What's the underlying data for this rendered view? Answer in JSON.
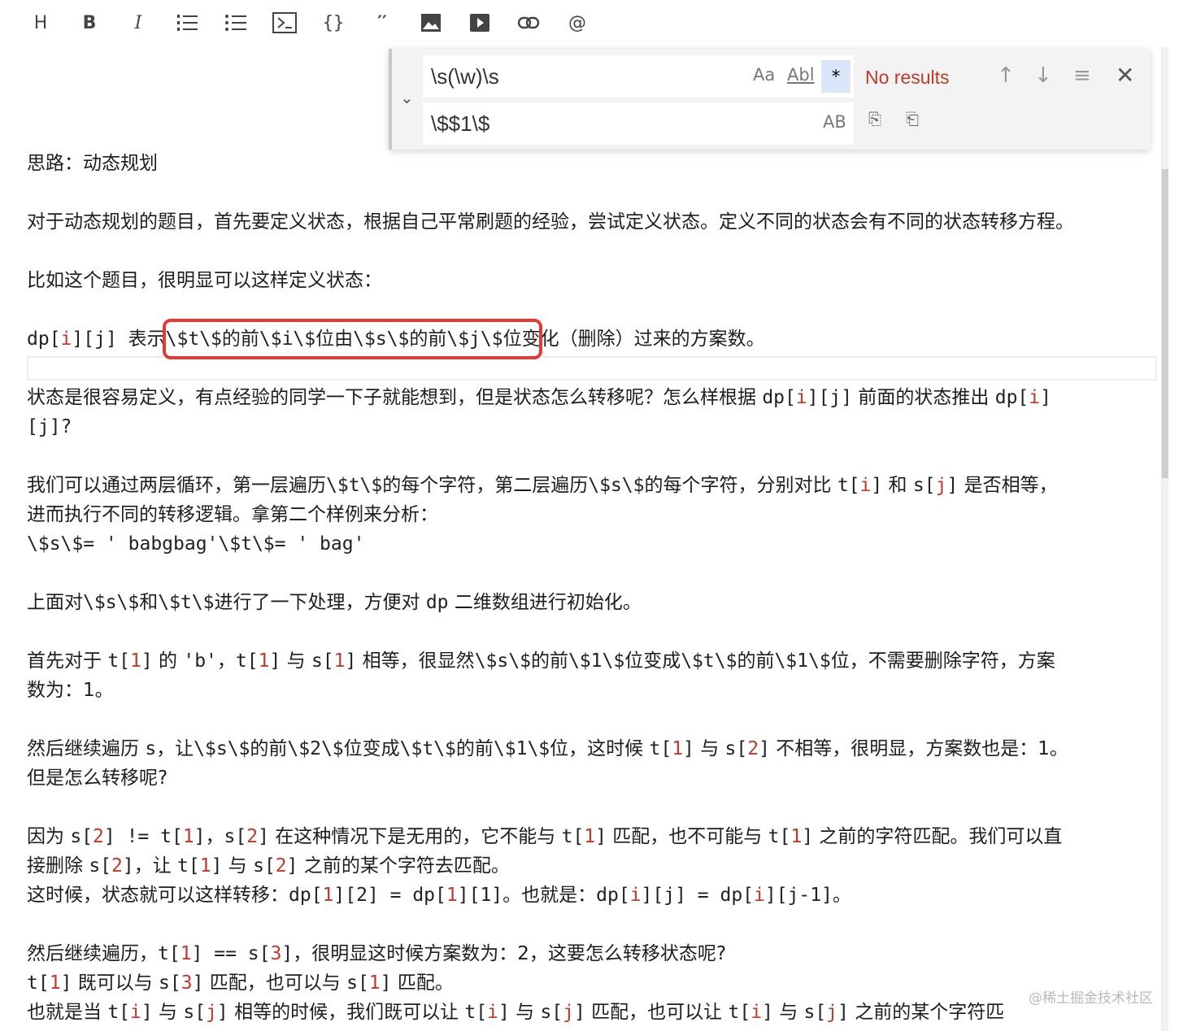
{
  "toolbar": {
    "heading": "H",
    "bold": "B",
    "italic": "I",
    "ordered_list": "≔",
    "unordered_list": "☰",
    "code_block": "⊳",
    "inline_code": "{}",
    "quote": "′′",
    "image": "▣",
    "video": "▶",
    "link": "⊘",
    "mention": "@"
  },
  "find_widget": {
    "search_value": "\\s(\\w)\\s",
    "replace_value": "\\$$1\\$",
    "match_case": "Aa",
    "whole_word": "Abl",
    "regex": "*",
    "preserve_case": "AB",
    "status": "No results",
    "prev": "↑",
    "next": "↓",
    "selection": "≡",
    "close": "✕",
    "replace_one": "⎘",
    "replace_all": "⎗",
    "toggle": "⌄"
  },
  "document": {
    "title_line": "思路：动态规划",
    "p1": "对于动态规划的题目，首先要定义状态，根据自己平常刷题的经验，尝试定义状态。定义不同的状态会有不同的状态转移方程。",
    "p2": "比如这个题目，很明显可以这样定义状态：",
    "p3": [
      {
        "t": "dp[",
        "c": "code"
      },
      {
        "t": "i",
        "c": "code red"
      },
      {
        "t": "][j] ",
        "c": "code"
      },
      {
        "t": "表示",
        "c": ""
      },
      {
        "t": "\\$t\\$的前\\$i\\$位由\\$s\\$的前\\$j\\$位",
        "c": "code"
      },
      {
        "t": "变化（删除）过来的方案数。",
        "c": ""
      }
    ],
    "p4a": [
      {
        "t": "状态是很容易定义，有点经验的同学一下子就能想到，但是状态怎么转移呢？怎么样根据 ",
        "c": ""
      },
      {
        "t": "dp[",
        "c": "code"
      },
      {
        "t": "i",
        "c": "code red"
      },
      {
        "t": "][j]",
        "c": "code"
      },
      {
        "t": " 前面的状态推出 ",
        "c": ""
      },
      {
        "t": "dp[",
        "c": "code"
      },
      {
        "t": "i",
        "c": "code red"
      },
      {
        "t": "]",
        "c": "code"
      }
    ],
    "p4b": "[j]?",
    "p5a": [
      {
        "t": "我们可以通过两层循环，第一层遍历",
        "c": ""
      },
      {
        "t": "\\$t\\$",
        "c": "code"
      },
      {
        "t": "的每个字符，第二层遍历",
        "c": ""
      },
      {
        "t": "\\$s\\$",
        "c": "code"
      },
      {
        "t": "的每个字符，分别对比 ",
        "c": ""
      },
      {
        "t": "t[",
        "c": "code"
      },
      {
        "t": "i",
        "c": "code red"
      },
      {
        "t": "]",
        "c": "code"
      },
      {
        "t": " 和 ",
        "c": ""
      },
      {
        "t": "s[",
        "c": "code"
      },
      {
        "t": "j",
        "c": "code red"
      },
      {
        "t": "]",
        "c": "code"
      },
      {
        "t": " 是否相等，",
        "c": ""
      }
    ],
    "p5b": "进而执行不同的转移逻辑。拿第二个样例来分析：",
    "p5c": "\\$s\\$= ' babgbag'\\$t\\$= ' bag'",
    "p6": [
      {
        "t": "上面对",
        "c": ""
      },
      {
        "t": "\\$s\\$",
        "c": "code"
      },
      {
        "t": "和",
        "c": ""
      },
      {
        "t": "\\$t\\$",
        "c": "code"
      },
      {
        "t": "进行了一下处理，方便对 ",
        "c": ""
      },
      {
        "t": "dp",
        "c": "code"
      },
      {
        "t": " 二维数组进行初始化。",
        "c": ""
      }
    ],
    "p7a": [
      {
        "t": "首先对于 ",
        "c": ""
      },
      {
        "t": "t[",
        "c": "code"
      },
      {
        "t": "1",
        "c": "code red"
      },
      {
        "t": "]",
        "c": "code"
      },
      {
        "t": " 的 ",
        "c": ""
      },
      {
        "t": "'b'",
        "c": "code"
      },
      {
        "t": "，",
        "c": ""
      },
      {
        "t": "t[",
        "c": "code"
      },
      {
        "t": "1",
        "c": "code red"
      },
      {
        "t": "]",
        "c": "code"
      },
      {
        "t": " 与 ",
        "c": ""
      },
      {
        "t": "s[",
        "c": "code"
      },
      {
        "t": "1",
        "c": "code red"
      },
      {
        "t": "]",
        "c": "code"
      },
      {
        "t": " 相等，很显然",
        "c": ""
      },
      {
        "t": "\\$s\\$",
        "c": "code"
      },
      {
        "t": "的前",
        "c": ""
      },
      {
        "t": "\\$1\\$",
        "c": "code"
      },
      {
        "t": "位变成",
        "c": ""
      },
      {
        "t": "\\$t\\$",
        "c": "code"
      },
      {
        "t": "的前",
        "c": ""
      },
      {
        "t": "\\$1\\$",
        "c": "code"
      },
      {
        "t": "位，不需要删除字符，方案",
        "c": ""
      }
    ],
    "p7b": "数为：1。",
    "p8a": [
      {
        "t": "然后继续遍历 ",
        "c": ""
      },
      {
        "t": "s",
        "c": "code"
      },
      {
        "t": "，让",
        "c": ""
      },
      {
        "t": "\\$s\\$",
        "c": "code"
      },
      {
        "t": "的前",
        "c": ""
      },
      {
        "t": "\\$2\\$",
        "c": "code"
      },
      {
        "t": "位变成",
        "c": ""
      },
      {
        "t": "\\$t\\$",
        "c": "code"
      },
      {
        "t": "的前",
        "c": ""
      },
      {
        "t": "\\$1\\$",
        "c": "code"
      },
      {
        "t": "位，这时候 ",
        "c": ""
      },
      {
        "t": "t[",
        "c": "code"
      },
      {
        "t": "1",
        "c": "code red"
      },
      {
        "t": "]",
        "c": "code"
      },
      {
        "t": " 与 ",
        "c": ""
      },
      {
        "t": "s[",
        "c": "code"
      },
      {
        "t": "2",
        "c": "code red"
      },
      {
        "t": "]",
        "c": "code"
      },
      {
        "t": " 不相等，很明显，方案数也是：1。",
        "c": ""
      }
    ],
    "p8b": "但是怎么转移呢?",
    "p9a": [
      {
        "t": "因为 ",
        "c": ""
      },
      {
        "t": "s[",
        "c": "code"
      },
      {
        "t": "2",
        "c": "code red"
      },
      {
        "t": "] != t[",
        "c": "code"
      },
      {
        "t": "1",
        "c": "code red"
      },
      {
        "t": "]",
        "c": "code"
      },
      {
        "t": "，",
        "c": ""
      },
      {
        "t": "s[",
        "c": "code"
      },
      {
        "t": "2",
        "c": "code red"
      },
      {
        "t": "]",
        "c": "code"
      },
      {
        "t": " 在这种情况下是无用的，它不能与 ",
        "c": ""
      },
      {
        "t": "t[",
        "c": "code"
      },
      {
        "t": "1",
        "c": "code red"
      },
      {
        "t": "]",
        "c": "code"
      },
      {
        "t": " 匹配，也不可能与 ",
        "c": ""
      },
      {
        "t": "t[",
        "c": "code"
      },
      {
        "t": "1",
        "c": "code red"
      },
      {
        "t": "]",
        "c": "code"
      },
      {
        "t": " 之前的字符匹配。我们可以直",
        "c": ""
      }
    ],
    "p9b": [
      {
        "t": "接删除 ",
        "c": ""
      },
      {
        "t": "s[",
        "c": "code"
      },
      {
        "t": "2",
        "c": "code red"
      },
      {
        "t": "]",
        "c": "code"
      },
      {
        "t": "，让 ",
        "c": ""
      },
      {
        "t": "t[",
        "c": "code"
      },
      {
        "t": "1",
        "c": "code red"
      },
      {
        "t": "]",
        "c": "code"
      },
      {
        "t": " 与 ",
        "c": ""
      },
      {
        "t": "s[",
        "c": "code"
      },
      {
        "t": "2",
        "c": "code red"
      },
      {
        "t": "]",
        "c": "code"
      },
      {
        "t": " 之前的某个字符去匹配。",
        "c": ""
      }
    ],
    "p9c": [
      {
        "t": "这时候，状态就可以这样转移：",
        "c": ""
      },
      {
        "t": "dp[",
        "c": "code"
      },
      {
        "t": "1",
        "c": "code red"
      },
      {
        "t": "][2] = dp[",
        "c": "code"
      },
      {
        "t": "1",
        "c": "code red"
      },
      {
        "t": "][1]",
        "c": "code"
      },
      {
        "t": "。也就是：",
        "c": ""
      },
      {
        "t": "dp[",
        "c": "code"
      },
      {
        "t": "i",
        "c": "code red"
      },
      {
        "t": "][j] = dp[",
        "c": "code"
      },
      {
        "t": "i",
        "c": "code red"
      },
      {
        "t": "][j-1]",
        "c": "code"
      },
      {
        "t": "。",
        "c": ""
      }
    ],
    "p10a": [
      {
        "t": "然后继续遍历，",
        "c": ""
      },
      {
        "t": "t[",
        "c": "code"
      },
      {
        "t": "1",
        "c": "code red"
      },
      {
        "t": "] == s[",
        "c": "code"
      },
      {
        "t": "3",
        "c": "code red"
      },
      {
        "t": "]",
        "c": "code"
      },
      {
        "t": "，很明显这时候方案数为：2，这要怎么转移状态呢?",
        "c": ""
      }
    ],
    "p10b": [
      {
        "t": "t[",
        "c": "code"
      },
      {
        "t": "1",
        "c": "code red"
      },
      {
        "t": "]",
        "c": "code"
      },
      {
        "t": " 既可以与 ",
        "c": ""
      },
      {
        "t": "s[",
        "c": "code"
      },
      {
        "t": "3",
        "c": "code red"
      },
      {
        "t": "]",
        "c": "code"
      },
      {
        "t": " 匹配，也可以与 ",
        "c": ""
      },
      {
        "t": "s[",
        "c": "code"
      },
      {
        "t": "1",
        "c": "code red"
      },
      {
        "t": "]",
        "c": "code"
      },
      {
        "t": " 匹配。",
        "c": ""
      }
    ],
    "p10c": [
      {
        "t": "也就是当 ",
        "c": ""
      },
      {
        "t": "t[",
        "c": "code"
      },
      {
        "t": "i",
        "c": "code red"
      },
      {
        "t": "]",
        "c": "code"
      },
      {
        "t": " 与 ",
        "c": ""
      },
      {
        "t": "s[",
        "c": "code"
      },
      {
        "t": "j",
        "c": "code red"
      },
      {
        "t": "]",
        "c": "code"
      },
      {
        "t": " 相等的时候，我们既可以让 ",
        "c": ""
      },
      {
        "t": "t[",
        "c": "code"
      },
      {
        "t": "i",
        "c": "code red"
      },
      {
        "t": "]",
        "c": "code"
      },
      {
        "t": " 与 ",
        "c": ""
      },
      {
        "t": "s[",
        "c": "code"
      },
      {
        "t": "j",
        "c": "code red"
      },
      {
        "t": "]",
        "c": "code"
      },
      {
        "t": " 匹配，也可以让 ",
        "c": ""
      },
      {
        "t": "t[",
        "c": "code"
      },
      {
        "t": "i",
        "c": "code red"
      },
      {
        "t": "]",
        "c": "code"
      },
      {
        "t": " 与 ",
        "c": ""
      },
      {
        "t": "s[",
        "c": "code"
      },
      {
        "t": "j",
        "c": "code red"
      },
      {
        "t": "]",
        "c": "code"
      },
      {
        "t": " 之前的某个字符匹",
        "c": ""
      }
    ]
  },
  "watermark": "@稀土掘金技术社区"
}
